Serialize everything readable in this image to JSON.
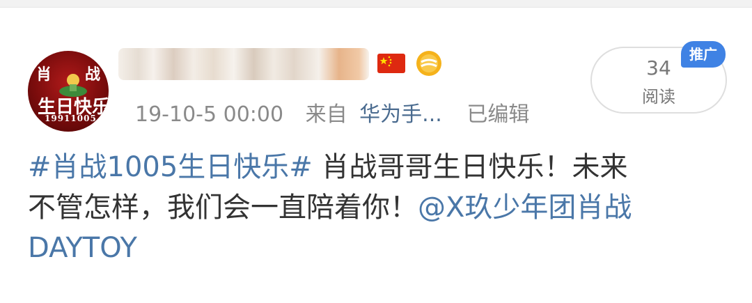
{
  "post": {
    "avatar": {
      "text_top_left": "肖",
      "text_top_right": "战",
      "text_middle": "生日快乐",
      "text_bottom": "19911005"
    },
    "flag_icon": "china-flag-icon",
    "badge_icon": "sun-badge-icon",
    "meta": {
      "time": "19-10-5 00:00",
      "from_label": "来自",
      "device": "华为手...",
      "edited": "已编辑"
    },
    "reads": {
      "count": "34",
      "label": "阅读"
    },
    "promo_badge": "推广",
    "content": {
      "hashtag": "#肖战1005生日快乐#",
      "line1_text": " 肖战哥哥生日快乐！未来",
      "line2_text": "不管怎样，我们会一直陪着你！",
      "mention_part1": "@X玖少年团肖战",
      "mention_part2": "DAYTOY"
    }
  },
  "colors": {
    "link_blue": "#4a77a8",
    "meta_gray": "#8a8a8a",
    "promo_blue": "#3f82e4",
    "avatar_red": "#9a1010"
  }
}
